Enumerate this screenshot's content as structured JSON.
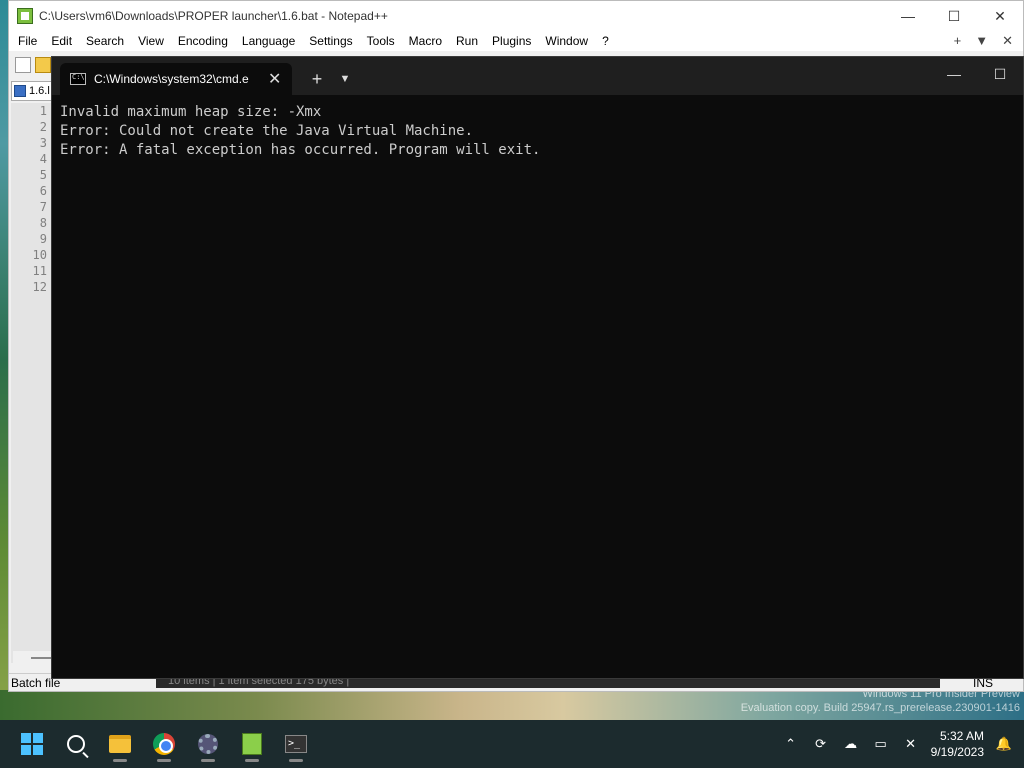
{
  "notepad": {
    "title": "C:\\Users\\vm6\\Downloads\\PROPER launcher\\1.6.bat - Notepad++",
    "menu": [
      "File",
      "Edit",
      "Search",
      "View",
      "Encoding",
      "Language",
      "Settings",
      "Tools",
      "Macro",
      "Run",
      "Plugins",
      "Window",
      "?"
    ],
    "menu_right": [
      "+",
      "▼",
      "✕"
    ],
    "tab_label": "1.6.l",
    "line_numbers": [
      "1",
      "2",
      "3",
      "4",
      "5",
      "6",
      "7",
      "8",
      "9",
      "10",
      "11",
      "12"
    ],
    "status_left": "Batch file",
    "status_right": "INS"
  },
  "explorer_status": "10 items  |  1 item selected  175 bytes  |",
  "terminal": {
    "tab_title": "C:\\Windows\\system32\\cmd.e",
    "lines": [
      "Invalid maximum heap size: -Xmx",
      "Error: Could not create the Java Virtual Machine.",
      "Error: A fatal exception has occurred. Program will exit."
    ]
  },
  "watermark": {
    "line1": "Windows 11 Pro Insider Preview",
    "line2": "Evaluation copy. Build 25947.rs_prerelease.230901-1416"
  },
  "clock": {
    "time": "5:32 AM",
    "date": "9/19/2023"
  }
}
